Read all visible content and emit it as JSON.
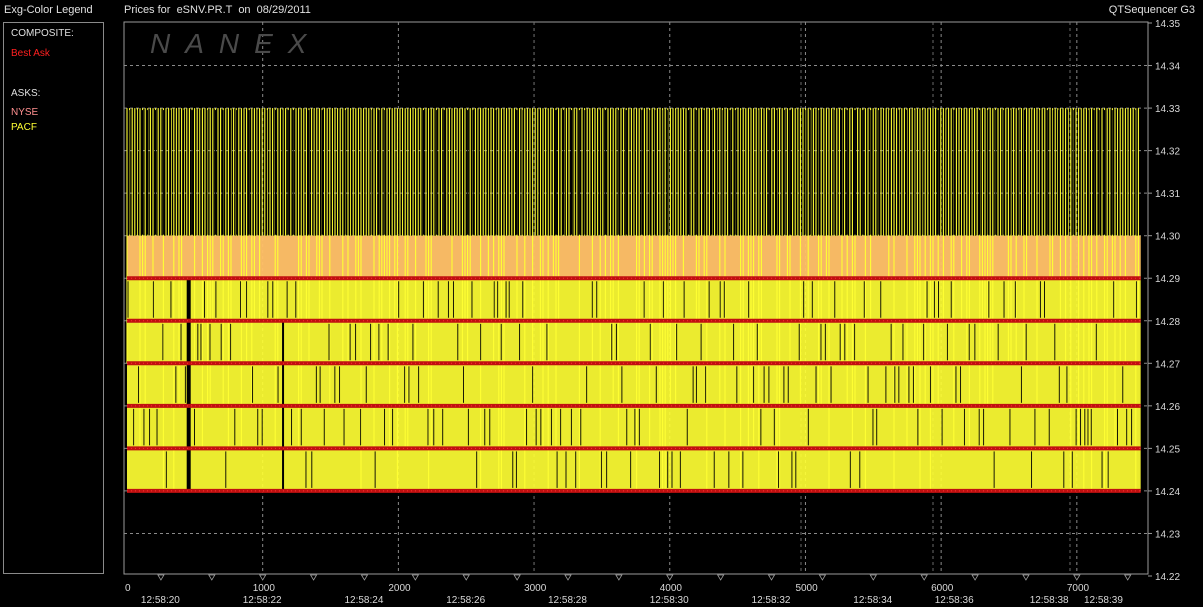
{
  "header": {
    "legend_title": "Exg-Color Legend",
    "chart_title": "Prices for  eSNV.PR.T  on  08/29/2011",
    "app_name": "QTSequencer G3"
  },
  "legend": {
    "composite_heading": "COMPOSITE:",
    "composite_items": [
      {
        "label": "Best Ask",
        "color": "#ff2020"
      }
    ],
    "asks_heading": "ASKS:",
    "ask_items": [
      {
        "label": "NYSE",
        "color": "#ff9090"
      },
      {
        "label": "PACF",
        "color": "#ffff33"
      }
    ]
  },
  "watermark": "NANEX",
  "chart_data": {
    "type": "line",
    "title": "Prices for  eSNV.PR.T  on  08/29/2011",
    "ylim": [
      14.22,
      14.35
    ],
    "y_ticks": [
      "14.35",
      "14.34",
      "14.33",
      "14.32",
      "14.31",
      "14.30",
      "14.29",
      "14.28",
      "14.27",
      "14.26",
      "14.25",
      "14.24",
      "14.23",
      "14.22"
    ],
    "xlim": [
      0,
      7500
    ],
    "x_seq_ticks": [
      0,
      1000,
      2000,
      3000,
      4000,
      5000,
      6000,
      7000
    ],
    "x_time_labels": [
      {
        "seq": 250,
        "label": "12:58:20"
      },
      {
        "seq": 1000,
        "label": "12:58:22"
      },
      {
        "seq": 1750,
        "label": "12:58:24"
      },
      {
        "seq": 2500,
        "label": "12:58:26"
      },
      {
        "seq": 3250,
        "label": "12:58:28"
      },
      {
        "seq": 4000,
        "label": "12:58:30"
      },
      {
        "seq": 4750,
        "label": "12:58:32"
      },
      {
        "seq": 5500,
        "label": "12:58:34"
      },
      {
        "seq": 6100,
        "label": "12:58:36"
      },
      {
        "seq": 6800,
        "label": "12:58:38"
      },
      {
        "seq": 7200,
        "label": "12:58:39"
      }
    ],
    "grid": true,
    "series": [
      {
        "name": "PACF",
        "color": "#ffff33",
        "style": "oscillating",
        "range": [
          14.24,
          14.33
        ]
      },
      {
        "name": "NYSE",
        "color": "#ff9090",
        "style": "oscillating",
        "range": [
          14.24,
          14.3
        ]
      },
      {
        "name": "Best Ask",
        "color": "#c01010",
        "style": "levels",
        "levels": [
          14.24,
          14.25,
          14.26,
          14.27,
          14.28,
          14.29
        ]
      }
    ]
  }
}
